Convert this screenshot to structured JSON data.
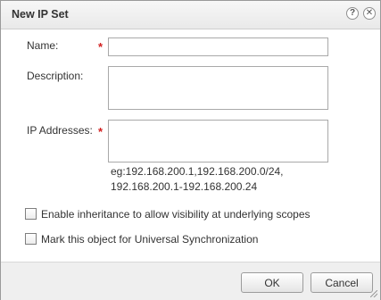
{
  "dialog": {
    "title": "New IP Set",
    "help_icon": "question-icon",
    "close_icon": "close-icon"
  },
  "form": {
    "name_label": "Name:",
    "name_value": "",
    "description_label": "Description:",
    "description_value": "",
    "ip_label": "IP Addresses:",
    "ip_value": "",
    "ip_hint_line1": "eg:192.168.200.1,192.168.200.0/24,",
    "ip_hint_line2": "192.168.200.1-192.168.200.24",
    "required_marker": "*",
    "inheritance_label": "Enable inheritance to allow visibility at underlying scopes",
    "inheritance_checked": false,
    "universal_label": "Mark this object for Universal Synchronization",
    "universal_checked": false
  },
  "footer": {
    "ok_label": "OK",
    "cancel_label": "Cancel"
  },
  "colors": {
    "required": "#d21f1f",
    "footer_bg": "#efefef"
  }
}
